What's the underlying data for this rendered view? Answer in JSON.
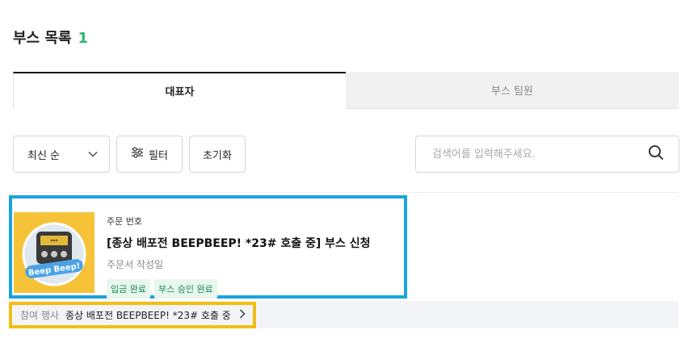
{
  "header": {
    "title": "부스 목록",
    "count": "1"
  },
  "tabs": [
    {
      "label": "대표자",
      "active": true
    },
    {
      "label": "부스 팀원",
      "active": false
    }
  ],
  "controls": {
    "sort_label": "최신 순",
    "filter_label": "필터",
    "reset_label": "초기화",
    "search_placeholder": "검색어를 입력해주세요.",
    "search_value": ""
  },
  "orders": [
    {
      "order_no_label": "주문 번호",
      "title": "[종상 배포전 BEEPBEEP! *23# 호출 중]  부스 신청",
      "date_label": "주문서 작성일",
      "badges": [
        "입금 완료",
        "부스 승인 완료"
      ],
      "thumbnail_text": "Beep Beep!"
    }
  ],
  "event": {
    "label": "참여 행사",
    "name": "종상 배포전 BEEPBEEP! *23# 호출 중"
  },
  "colors": {
    "accent_green": "#2bb673",
    "highlight_blue": "#1aa3e0",
    "highlight_yellow": "#f3be14",
    "badge_bg": "#e7f6ee",
    "badge_text": "#1a8a4e"
  }
}
